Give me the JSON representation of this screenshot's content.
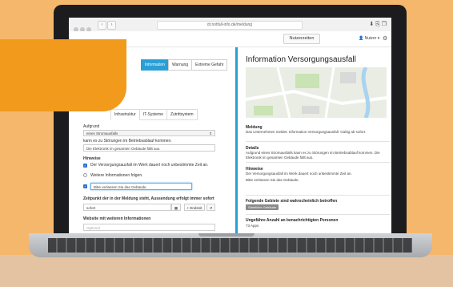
{
  "browser": {
    "url": "dr.notfall-info.de/meldung"
  },
  "app_header": {
    "manage_users_label": "Nutzerzeiten",
    "user_label": "Nutzer",
    "user_icon": "user-icon",
    "settings_icon": "gear-icon"
  },
  "form": {
    "type_tabs": [
      "Information",
      "Warnung",
      "Extreme Gefahr"
    ],
    "category_tabs": [
      "Infrastruktur",
      "IT-Systeme",
      "Zutrittsystem"
    ],
    "grund_label": "Aufgrund",
    "grund_value": "eines Stromausfalls",
    "grund_suffix": "kann es zu Störungen im Betriebsablauf kommen.",
    "grund_detail_value": "Die Elektronik im gesamten Gebäude fällt aus.",
    "hinweise_label": "Hinweise",
    "hinweis1": "Der Versorgungsausfall im Werk dauert noch unbestimmte Zeit an.",
    "hinweis2": "Weitere Informationen folgen.",
    "hinweis3_value": "Bitte verlassen Sie das Gebäude",
    "zeitpunkt_label": "Zeitpunkt der in der Meldung steht, Aussendung erfolgt immer sofort",
    "zeitpunkt_value": "sofort",
    "endzeit_label": "+ Endzeit",
    "website_label": "Website mit weiteren Informationen",
    "website_placeholder": "Optional"
  },
  "preview": {
    "title": "Information Versorgungsausfall",
    "meldung_label": "Meldung",
    "meldung_text": "Das Unternehmen meldet: Information Versorgungsausfall. Gültig ab sofort.",
    "details_label": "Details",
    "details_text": "Aufgrund eines Stromausfalls kann es zu Störungen im Betriebsablauf kommen. Die Elektronik im gesamten Gebäude fällt aus.",
    "hinweise_label": "Hinweise",
    "hinweise_text1": "Der Versorgungsausfall im Werk dauert noch unbestimmte Zeit an.",
    "hinweise_text2": "Bitte verlassen Sie das Gebäude.",
    "gebiete_label": "Folgende Gebiete sind wahrscheinlich betroffen",
    "gebiete_badge": "Sämtliche Gebäude",
    "anzahl_label": "Ungefähre Anzahl an benachrichtigten Personen",
    "anzahl_value": "73 Apps"
  },
  "colors": {
    "accent": "#2a9fd6",
    "background": "#f5b76b",
    "orange_shape": "#f19a1c"
  }
}
